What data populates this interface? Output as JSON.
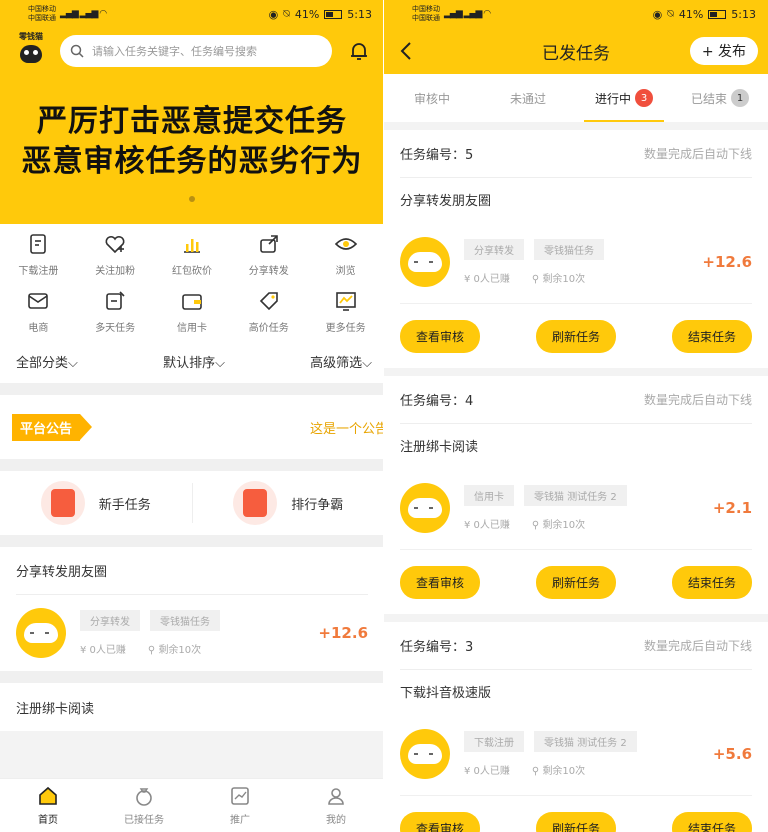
{
  "status": {
    "carrier1": "中国移动",
    "carrier2": "中国联通",
    "battery": "41%",
    "time": "5:13"
  },
  "left": {
    "logo_text": "零钱猫",
    "search_placeholder": "请输入任务关键字、任务编号搜索",
    "banner_line1": "严厉打击恶意提交任务",
    "banner_line2": "恶意审核任务的恶劣行为",
    "categories": [
      {
        "label": "下载注册",
        "icon": "download-icon"
      },
      {
        "label": "关注加粉",
        "icon": "heart-plus-icon"
      },
      {
        "label": "红包砍价",
        "icon": "bar-chart-icon"
      },
      {
        "label": "分享转发",
        "icon": "share-icon"
      },
      {
        "label": "浏览",
        "icon": "eye-icon"
      },
      {
        "label": "电商",
        "icon": "mail-icon"
      },
      {
        "label": "多天任务",
        "icon": "edit-icon"
      },
      {
        "label": "信用卡",
        "icon": "wallet-icon"
      },
      {
        "label": "高价任务",
        "icon": "tag-icon"
      },
      {
        "label": "更多任务",
        "icon": "trend-icon"
      }
    ],
    "filters": [
      "全部分类",
      "默认排序",
      "高级筛选"
    ],
    "notice_badge": "平台公告",
    "notice_text": "这是一个公告",
    "promos": [
      "新手任务",
      "排行争霸"
    ],
    "tasks": [
      {
        "title": "分享转发朋友圈",
        "tags": [
          "分享转发",
          "零钱猫任务"
        ],
        "earned": "0人已赚",
        "remaining": "剩余10次",
        "reward": "+12.6"
      },
      {
        "title": "注册绑卡阅读"
      }
    ],
    "tabbar": [
      "首页",
      "已接任务",
      "推广",
      "我的"
    ]
  },
  "right": {
    "title": "已发任务",
    "publish": "+ 发布",
    "tabs": [
      {
        "label": "审核中",
        "count": ""
      },
      {
        "label": "未通过",
        "count": ""
      },
      {
        "label": "进行中",
        "count": "3"
      },
      {
        "label": "已结束",
        "count": "1"
      }
    ],
    "auto_offline": "数量完成后自动下线",
    "tasks": [
      {
        "number": "任务编号：5",
        "name": "分享转发朋友圈",
        "tags": [
          "分享转发",
          "零钱猫任务"
        ],
        "earned": "0人已赚",
        "remaining": "剩余10次",
        "reward": "+12.6"
      },
      {
        "number": "任务编号：4",
        "name": "注册绑卡阅读",
        "tags": [
          "信用卡",
          "零钱猫 测试任务 2"
        ],
        "earned": "0人已赚",
        "remaining": "剩余10次",
        "reward": "+2.1"
      },
      {
        "number": "任务编号：3",
        "name": "下载抖音极速版",
        "tags": [
          "下载注册",
          "零钱猫 测试任务 2"
        ],
        "earned": "0人已赚",
        "remaining": "剩余10次",
        "reward": "+5.6"
      }
    ],
    "actions": [
      "查看审核",
      "刷新任务",
      "结束任务"
    ]
  }
}
